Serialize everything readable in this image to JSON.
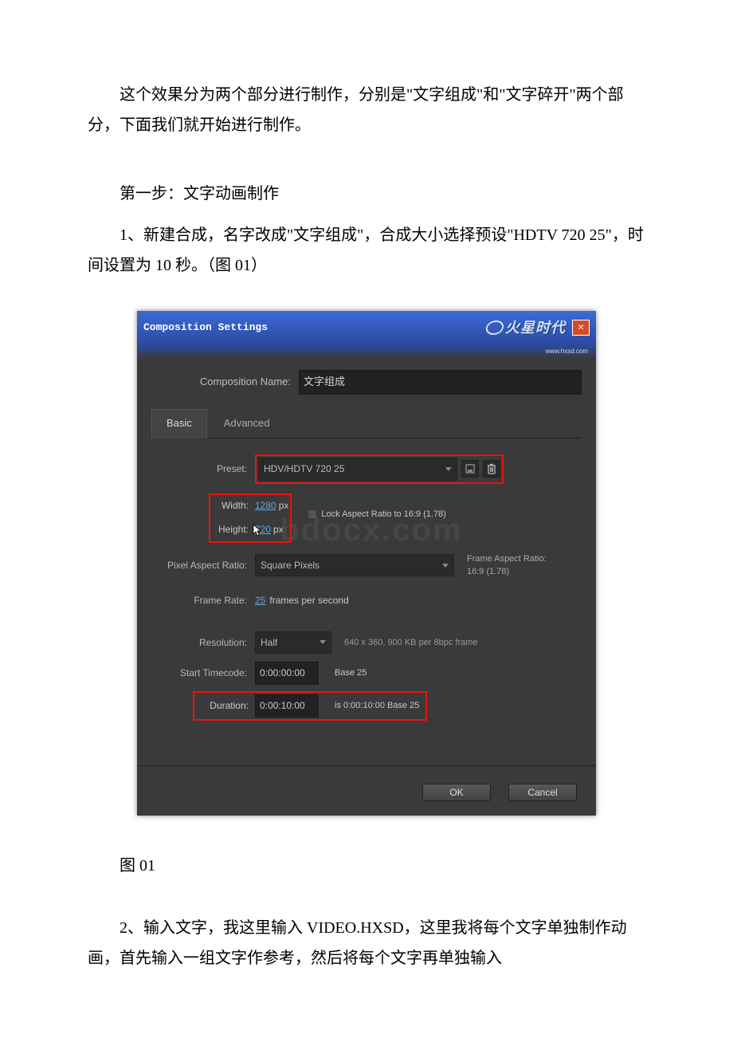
{
  "text": {
    "intro": "这个效果分为两个部分进行制作，分别是\"文字组成\"和\"文字碎开\"两个部分，下面我们就开始进行制作。",
    "step1_title": "第一步：文字动画制作",
    "step1_body": "1、新建合成，名字改成\"文字组成\"，合成大小选择预设\"HDTV 720 25\"，时间设置为 10 秒。（图 01）",
    "caption01": "图 01",
    "step2_body": "2、输入文字，我这里输入 VIDEO.HXSD，这里我将每个文字单独制作动画，首先输入一组文字作参考，然后将每个文字再单独输入"
  },
  "dialog": {
    "title": "Composition Settings",
    "logo_text": "火星时代",
    "logo_sub": "www.hxsd.com",
    "name_label": "Composition Name:",
    "name_value": "文字组成",
    "tabs": {
      "basic": "Basic",
      "advanced": "Advanced"
    },
    "preset": {
      "label": "Preset:",
      "value": "HDV/HDTV 720 25"
    },
    "width": {
      "label": "Width:",
      "value": "1280",
      "unit": "px"
    },
    "height": {
      "label": "Height:",
      "value": "720",
      "unit": "px"
    },
    "lock_ar": "Lock Aspect Ratio to 16:9 (1.78)",
    "par": {
      "label": "Pixel Aspect Ratio:",
      "value": "Square Pixels"
    },
    "far": {
      "line1": "Frame Aspect Ratio:",
      "line2": "16:9 (1.78)"
    },
    "framerate": {
      "label": "Frame Rate:",
      "value": "25",
      "suffix": "frames per second"
    },
    "resolution": {
      "label": "Resolution:",
      "value": "Half",
      "hint": "640 x 360, 900 KB per 8bpc frame"
    },
    "start_tc": {
      "label": "Start Timecode:",
      "value": "0:00:00:00",
      "base": "Base 25"
    },
    "duration": {
      "label": "Duration:",
      "value": "0:00:10:00",
      "hint": "is 0:00:10:00  Base 25"
    },
    "ok": "OK",
    "cancel": "Cancel",
    "watermark": "bdocx.com"
  }
}
